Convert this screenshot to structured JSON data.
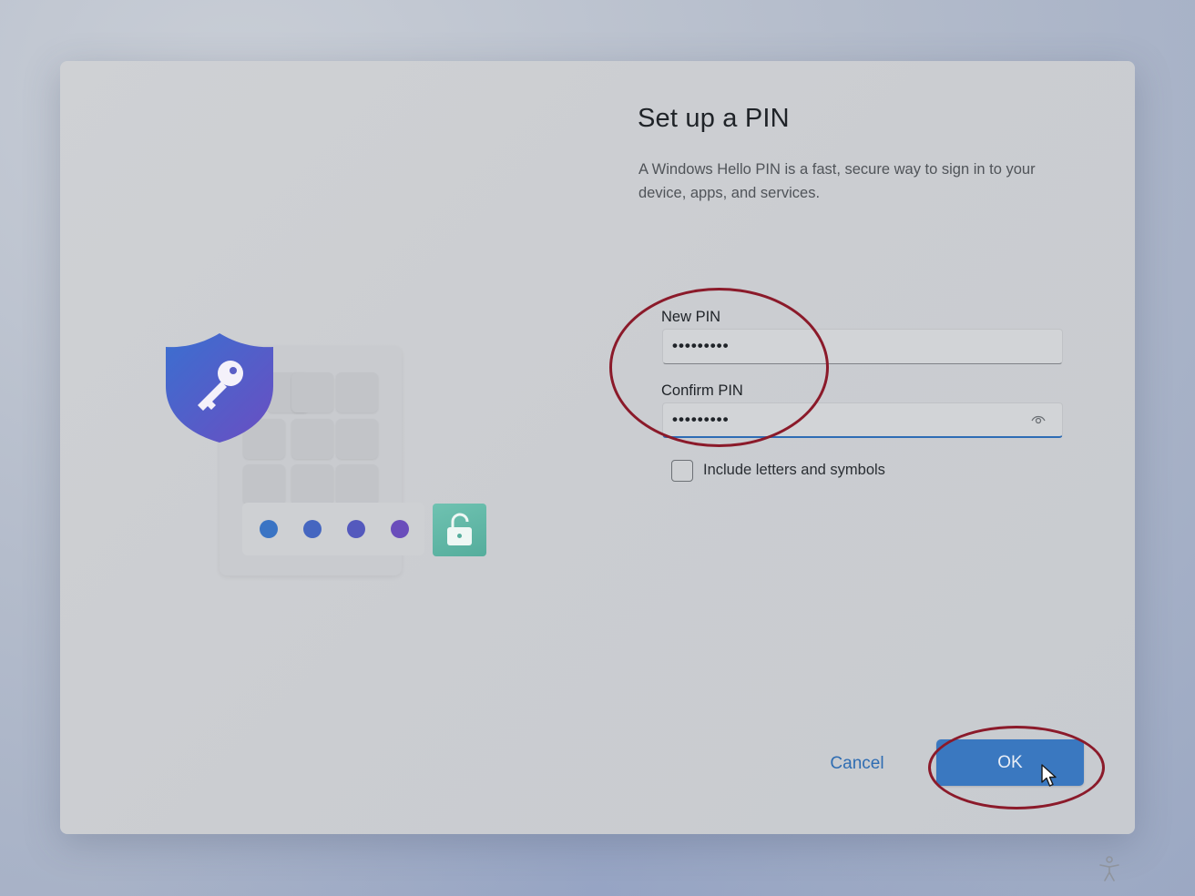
{
  "dialog": {
    "title": "Set up a PIN",
    "subtitle": "A Windows Hello PIN is a fast, secure way to sign in to your device, apps, and services."
  },
  "illustration": {
    "shield_icon": "shield-key-icon",
    "unlock_icon": "unlocked-padlock-icon",
    "pin_dot_colors": [
      "#3a74c4",
      "#4566c0",
      "#5459bd",
      "#6a4dbb"
    ],
    "unlock_tile_color": "#5fb8a6"
  },
  "form": {
    "new_pin": {
      "label": "New PIN",
      "value": "•••••••••"
    },
    "confirm_pin": {
      "label": "Confirm PIN",
      "value": "•••••••••",
      "reveal_icon": "eye-icon"
    },
    "include_letters": {
      "label": "Include letters and symbols",
      "checked": false
    }
  },
  "actions": {
    "cancel_label": "Cancel",
    "ok_label": "OK"
  },
  "colors": {
    "accent": "#3a78c0",
    "annotation": "#8b1a2a"
  },
  "footer": {
    "accessibility_icon": "accessibility-icon"
  }
}
